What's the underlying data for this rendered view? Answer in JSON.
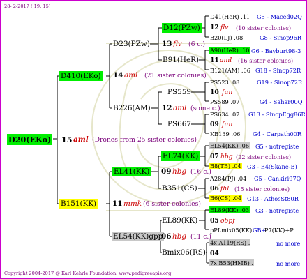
{
  "header": {
    "date": "28- 2-2017 ( 19: 15)"
  },
  "footer": {
    "copyright": "Copyright 2004-2017 @ Karl Kehrle Foundation.   www.pedigreeapis.org"
  },
  "root": {
    "id": "D20(EKo)",
    "gen": "15",
    "name": "aml",
    "note": "(Drones from 25 sister colonies)"
  },
  "g2": [
    {
      "id": "D410(EKo)",
      "gen": "14",
      "name": "aml",
      "note": "(21 sister colonies)"
    },
    {
      "id": "B151(KK)",
      "gen": "11",
      "name": "mmk",
      "note": "(6 sister colonies)"
    }
  ],
  "g3": [
    {
      "id": "D23(PZw)",
      "gen": "13",
      "name": "flv",
      "note": "(6 c.)"
    },
    {
      "id": "B226(AM)",
      "gen": "12",
      "name": "aml",
      "note": "(some c.)"
    },
    {
      "id": "EL41(KK)",
      "gen": "09",
      "name": "hbg",
      "note": "(16 c.)"
    },
    {
      "id": "EL54(KK)gpp",
      "gen": "06",
      "name": "hbg",
      "note": "(11 c.)"
    }
  ],
  "g4": [
    {
      "id": "D12(PZw)"
    },
    {
      "id": "B91(HeR)"
    },
    {
      "id": "PS559",
      "gen": "10",
      "name": "fun"
    },
    {
      "id": "PS667"
    },
    {
      "id": "EL74(KK)"
    },
    {
      "id": "B351(CS)"
    },
    {
      "id": "EL89(KK)",
      "gen": "05",
      "name": "obpf"
    },
    {
      "id": "Bmix06(RS)",
      "gen": "04"
    }
  ],
  "g5": [
    {
      "left": "D41(HeR) .11",
      "right": "G5 - Maced02Q"
    },
    {
      "gen": "12",
      "name": "flv",
      "note": "(10 sister colonies)"
    },
    {
      "left": "B20(LJ) .08",
      "right": "G8 - Sinop96R"
    },
    {
      "left": "A90(HeR) .10",
      "right": "G6 - Bayburt98-3"
    },
    {
      "gen": "11",
      "name": "aml",
      "note": "(16 sister colonies)"
    },
    {
      "left": "B121(AM) .06",
      "right": "G18 - Sinop72R"
    },
    {
      "left": "PS523 .08",
      "right": "G19 - Sinop72R"
    },
    {
      "gen": "10",
      "name": "fun"
    },
    {
      "left": "PS589 .07",
      "right": "G4 - Sahar00Q"
    },
    {
      "left": "PS634 .07",
      "right": "G13 - SinopEgg86R"
    },
    {
      "gen": "09",
      "name": "fun"
    },
    {
      "left": "KB139 .06",
      "right": "G4 - Carpath00R"
    },
    {
      "left": "EL54(KK) .06",
      "right": "G5 - notregiste"
    },
    {
      "gen": "07",
      "name": "hbg",
      "note": "(22 sister colonies)"
    },
    {
      "left": "B8(TB) .04",
      "right": "G3 - E4(Skane-B)"
    },
    {
      "left": "A284(PJ) .04",
      "right": "G5 - Cankiri97Q"
    },
    {
      "gen": "06",
      "name": "fhl",
      "note": "(15 sister colonies)"
    },
    {
      "left": "B6(CS) .04",
      "right": "G13 - AthosSt80R"
    },
    {
      "left": "EL89(KK) .03",
      "right": "G3 - notregiste"
    },
    {
      "gen": "05",
      "name": "obpf"
    },
    {
      "left": "pPLmix05(KK)",
      "mid": "GB+",
      "right": "P7(KK)+P"
    },
    {
      "left": "4x A119(RS) .",
      "right": "no more"
    },
    {
      "gen": "04"
    },
    {
      "left": "7x B53(HMB) .",
      "right": "no more"
    }
  ],
  "colors": {
    "border": "#cc00cc",
    "green": "#00ee00",
    "yellow": "#ffff00",
    "grey": "#c8c8c8",
    "red": "#cc0000",
    "blue": "#0000cc",
    "lines": "#000000"
  }
}
